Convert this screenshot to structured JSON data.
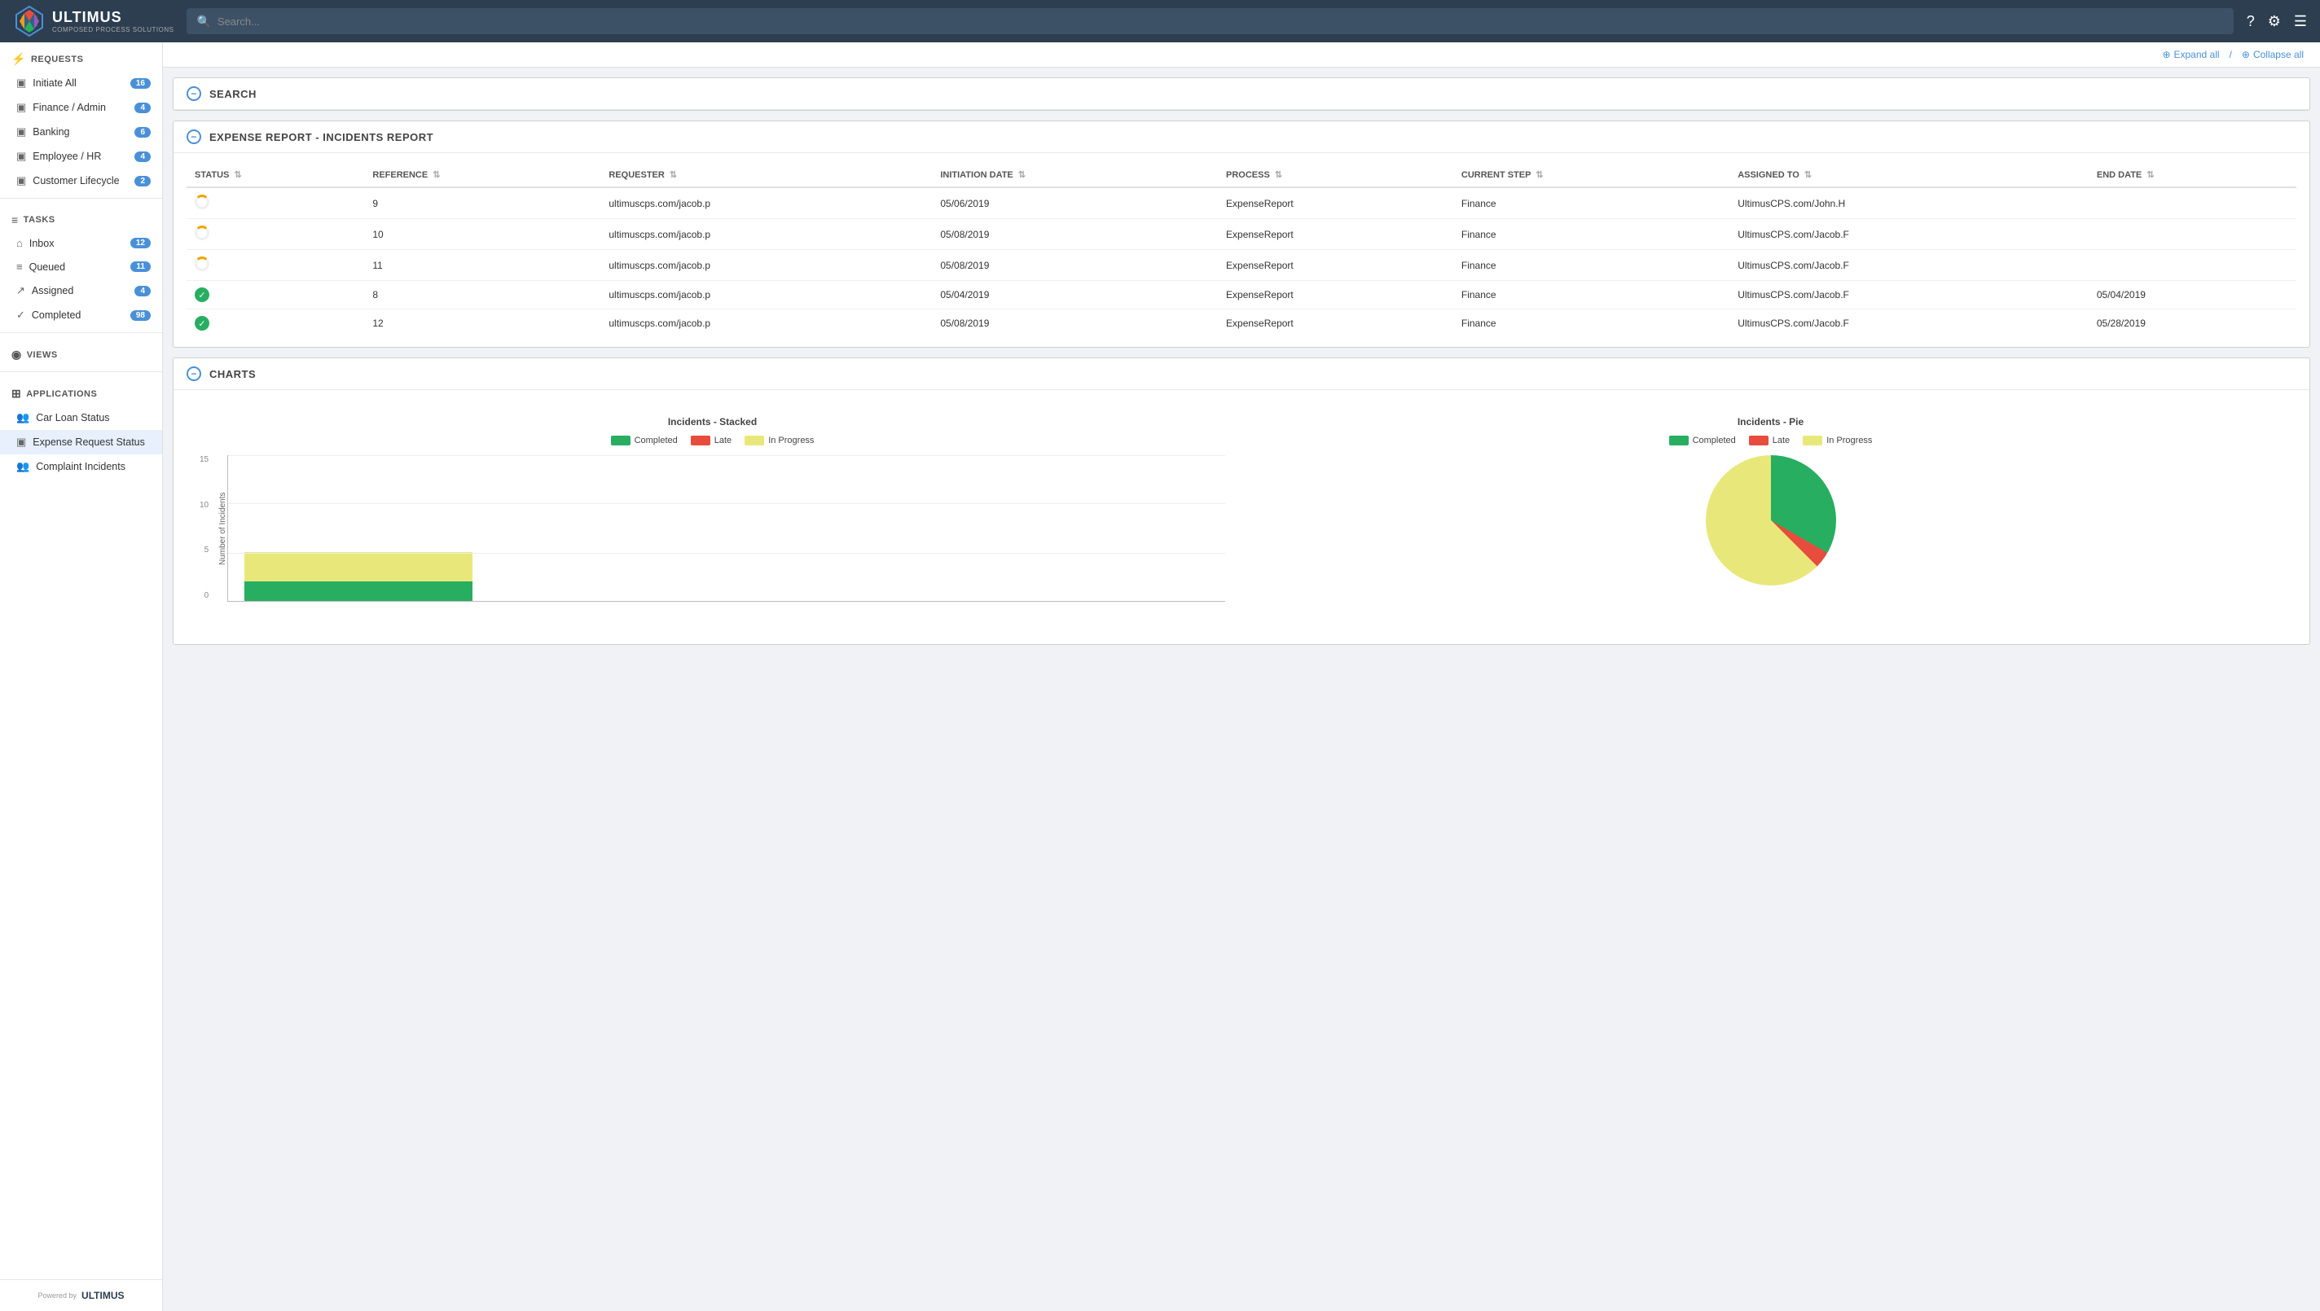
{
  "topbar": {
    "brand": "ULTIMUS",
    "subtitle": "COMPOSED PROCESS SOLUTIONS",
    "search_placeholder": "Search...",
    "url": "cpssolutions01.ultimuscps.com"
  },
  "sidebar": {
    "collapse_label": "‹",
    "sections": [
      {
        "id": "requests",
        "icon": "⚡",
        "label": "REQUESTS",
        "items": [
          {
            "id": "initiate-all",
            "icon": "▣",
            "label": "Initiate All",
            "badge": "16"
          },
          {
            "id": "finance-admin",
            "icon": "▣",
            "label": "Finance / Admin",
            "badge": "4"
          },
          {
            "id": "banking",
            "icon": "▣",
            "label": "Banking",
            "badge": "6"
          },
          {
            "id": "employee-hr",
            "icon": "▣",
            "label": "Employee / HR",
            "badge": "4"
          },
          {
            "id": "customer-lifecycle",
            "icon": "▣",
            "label": "Customer Lifecycle",
            "badge": "2"
          }
        ]
      },
      {
        "id": "tasks",
        "icon": "≡",
        "label": "TASKS",
        "items": [
          {
            "id": "inbox",
            "icon": "⌂",
            "label": "Inbox",
            "badge": "12"
          },
          {
            "id": "queued",
            "icon": "≡",
            "label": "Queued",
            "badge": "11"
          },
          {
            "id": "assigned",
            "icon": "↗",
            "label": "Assigned",
            "badge": "4"
          },
          {
            "id": "completed",
            "icon": "✓",
            "label": "Completed",
            "badge": "98"
          }
        ]
      },
      {
        "id": "views",
        "icon": "◉",
        "label": "VIEWS",
        "items": []
      },
      {
        "id": "applications",
        "icon": "⊞",
        "label": "APPLICATIONS",
        "items": [
          {
            "id": "car-loan-status",
            "icon": "👥",
            "label": "Car Loan Status",
            "active": false
          },
          {
            "id": "expense-request-status",
            "icon": "▣",
            "label": "Expense Request Status",
            "active": true
          },
          {
            "id": "complaint-incidents",
            "icon": "👥",
            "label": "Complaint Incidents",
            "active": false
          }
        ]
      }
    ],
    "footer": {
      "powered_by": "Powered by",
      "logo": "ULTIMUS"
    }
  },
  "toolbar": {
    "expand_all": "Expand all",
    "collapse_all": "Collapse all",
    "separator": "/"
  },
  "sections": {
    "search": {
      "title": "SEARCH"
    },
    "expense_report": {
      "title": "EXPENSE REPORT - INCIDENTS REPORT",
      "table": {
        "columns": [
          {
            "key": "status",
            "label": "STATUS"
          },
          {
            "key": "reference",
            "label": "REFERENCE"
          },
          {
            "key": "requester",
            "label": "REQUESTER"
          },
          {
            "key": "initiation_date",
            "label": "INITIATION DATE"
          },
          {
            "key": "process",
            "label": "PROCESS"
          },
          {
            "key": "current_step",
            "label": "CURRENT STEP"
          },
          {
            "key": "assigned_to",
            "label": "ASSIGNED TO"
          },
          {
            "key": "end_date",
            "label": "END DATE"
          }
        ],
        "rows": [
          {
            "status": "spinning",
            "reference": "9",
            "requester": "ultimuscps.com/jacob.p",
            "initiation_date": "05/06/2019",
            "process": "ExpenseReport",
            "current_step": "Finance",
            "assigned_to": "UltimusCPS.com/John.H",
            "end_date": ""
          },
          {
            "status": "spinning",
            "reference": "10",
            "requester": "ultimuscps.com/jacob.p",
            "initiation_date": "05/08/2019",
            "process": "ExpenseReport",
            "current_step": "Finance",
            "assigned_to": "UltimusCPS.com/Jacob.F",
            "end_date": ""
          },
          {
            "status": "spinning",
            "reference": "11",
            "requester": "ultimuscps.com/jacob.p",
            "initiation_date": "05/08/2019",
            "process": "ExpenseReport",
            "current_step": "Finance",
            "assigned_to": "UltimusCPS.com/Jacob.F",
            "end_date": ""
          },
          {
            "status": "done",
            "reference": "8",
            "requester": "ultimuscps.com/jacob.p",
            "initiation_date": "05/04/2019",
            "process": "ExpenseReport",
            "current_step": "Finance",
            "assigned_to": "UltimusCPS.com/Jacob.F",
            "end_date": "05/04/2019"
          },
          {
            "status": "done",
            "reference": "12",
            "requester": "ultimuscps.com/jacob.p",
            "initiation_date": "05/08/2019",
            "process": "ExpenseReport",
            "current_step": "Finance",
            "assigned_to": "UltimusCPS.com/Jacob.F",
            "end_date": "05/28/2019"
          }
        ]
      }
    },
    "charts": {
      "title": "CHARTS",
      "stacked_chart": {
        "title": "Incidents - Stacked",
        "legend": [
          {
            "label": "Completed",
            "color": "#27ae60"
          },
          {
            "label": "Late",
            "color": "#e74c3c"
          },
          {
            "label": "In Progress",
            "color": "#e8e87a"
          }
        ],
        "y_axis_label": "Number of Incidents",
        "y_ticks": [
          "15",
          "10",
          "5",
          "0"
        ],
        "bars": [
          {
            "completed": 2,
            "late": 0,
            "in_progress": 3,
            "total": 5
          }
        ],
        "max": 15
      },
      "pie_chart": {
        "title": "Incidents - Pie",
        "legend": [
          {
            "label": "Completed",
            "color": "#27ae60"
          },
          {
            "label": "Late",
            "color": "#e74c3c"
          },
          {
            "label": "In Progress",
            "color": "#e8e87a"
          }
        ],
        "segments": {
          "completed_deg": 120,
          "late_deg": 15,
          "in_progress_deg": 225
        }
      }
    }
  }
}
